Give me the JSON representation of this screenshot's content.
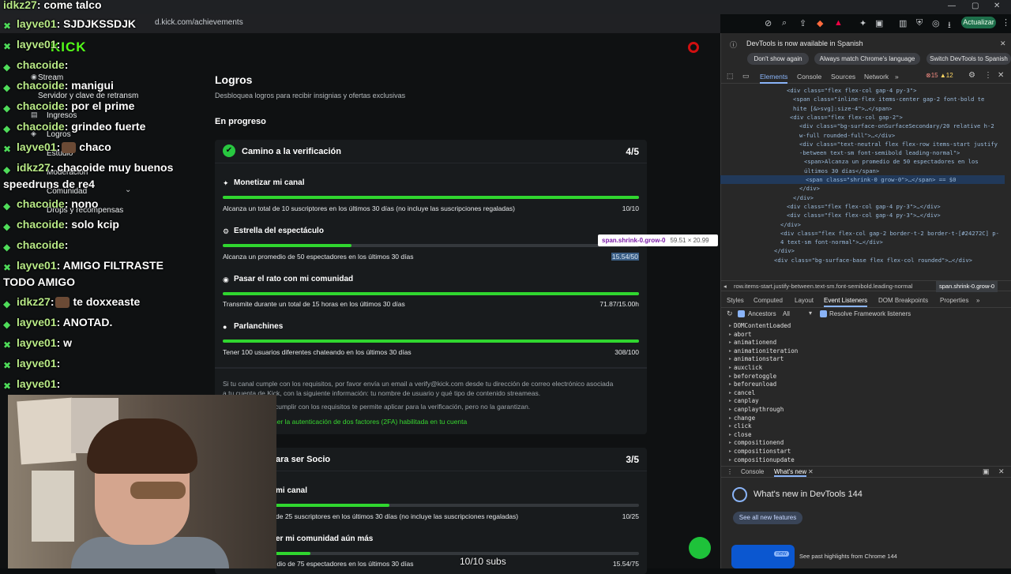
{
  "browser": {
    "url": "d.kick.com/achievements",
    "update_label": "Actualizar"
  },
  "sidebar": {
    "items": [
      {
        "icon": "radio-icon",
        "label": "Stream"
      },
      {
        "icon": "key-icon",
        "label": "Servidor y clave de retransm"
      },
      {
        "icon": "dollar-icon",
        "label": "Ingresos"
      },
      {
        "icon": "medal-icon",
        "label": "Logros"
      },
      {
        "icon": "studio-icon",
        "label": "Estudio"
      },
      {
        "icon": "shield-icon",
        "label": "Moderación"
      },
      {
        "icon": "users-icon",
        "label": "Comunidad"
      },
      {
        "icon": "gift-icon",
        "label": "Drops y recompensas"
      }
    ]
  },
  "page": {
    "title": "Logros",
    "subtitle": "Desbloquea logros para recibir insignias y ofertas exclusivas",
    "section": "En progreso"
  },
  "cards": [
    {
      "title": "Camino a la verificación",
      "count": "4/5",
      "achievements": [
        {
          "icon": "sparkle-icon",
          "title": "Monetizar mi canal",
          "desc": "Alcanza un total de 10 suscriptores en los últimos 30 días (no incluye las suscripciones regaladas)",
          "value": "10/10",
          "progress": 1.0
        },
        {
          "icon": "star-icon",
          "title": "Estrella del espectáculo",
          "desc": "Alcanza un promedio de 50 espectadores en los últimos 30 días",
          "value": "15.54/50",
          "progress": 0.31
        },
        {
          "icon": "broadcast-icon",
          "title": "Pasar el rato con mi comunidad",
          "desc": "Transmite durante un total de 15 horas en los últimos 30 días",
          "value": "71.87/15.00h",
          "progress": 1.0
        },
        {
          "icon": "chat-icon",
          "title": "Parlanchines",
          "desc": "Tener 100 usuarios diferentes chateando en los últimos 30 días",
          "value": "308/100",
          "progress": 1.0
        }
      ],
      "info_line1": "Si tu canal cumple con los requisitos, por favor envía un email a verify@kick.com desde tu dirección de correo electrónico asociada",
      "info_line2": "a tu cuenta de Kick, con la siguiente información: tu nombre de usuario y qué tipo de contenido streameas.",
      "info_line3": "cumplir con los requisitos te permite aplicar para la verificación, pero no la garantizan.",
      "info_link": "ner la autenticación de dos factores (2FA) habilitada en tu cuenta"
    },
    {
      "title": "ara ser Socio",
      "count": "3/5",
      "achievements": [
        {
          "title": "mi canal",
          "desc": "de 25 suscriptores en los últimos 30 días (no incluye las suscripciones regaladas)",
          "value": "10/25",
          "progress": 0.4
        },
        {
          "title": "er mi comunidad aún más",
          "desc": "Alcanza un promedio de 75 espectadores en los últimos 30 días",
          "value": "15.54/75",
          "progress": 0.21
        }
      ]
    }
  ],
  "tooltip": {
    "selector": "span.shrink-0.grow-0",
    "size": "59.51 × 20.99"
  },
  "chat": [
    {
      "user": "idkz27",
      "msg": ": come talco"
    },
    {
      "user": "layve01",
      "msg": ": SJDJKSSDJK"
    },
    {
      "user": "layve01",
      "msg": ":"
    },
    {
      "user": "chacoide",
      "msg": ":"
    },
    {
      "user": "chacoide",
      "msg": ": manigui"
    },
    {
      "user": "chacoide",
      "msg": ": por el prime"
    },
    {
      "user": "chacoide",
      "msg": ": grindeo fuerte"
    },
    {
      "user": "layve01",
      "msg": ":",
      "extra": "chaco"
    },
    {
      "user": "idkz27",
      "msg": ": chacoide muy buenos"
    },
    {
      "user": "",
      "msg": "speedruns de re4"
    },
    {
      "user": "chacoide",
      "msg": ": nono"
    },
    {
      "user": "chacoide",
      "msg": ": solo kcip"
    },
    {
      "user": "chacoide",
      "msg": ":"
    },
    {
      "user": "layve01",
      "msg": ": AMIGO FILTRASTE"
    },
    {
      "user": "",
      "msg": "TODO AMIGO"
    },
    {
      "user": "idkz27",
      "msg": ":",
      "extra": "te doxxeaste"
    },
    {
      "user": "layve01",
      "msg": ": ANOTAD."
    },
    {
      "user": "layve01",
      "msg": ": w"
    },
    {
      "user": "layve01",
      "msg": ":"
    },
    {
      "user": "layve01",
      "msg": ":"
    }
  ],
  "overlay_subs": "10/10 subs",
  "devtools": {
    "info_msg": "DevTools is now available in Spanish",
    "btn_dont_show": "Don't show again",
    "btn_match": "Always match Chrome's language",
    "btn_switch": "Switch DevTools to Spanish",
    "tabs": [
      "Elements",
      "Console",
      "Sources",
      "Network"
    ],
    "errors": "15",
    "warnings": "12",
    "dom_lines": [
      "<div class=\"flex flex-col gap-4 py-3\">",
      "<span class=\"inline-flex items-center gap-2 font-bold te",
      "hite [&>svg]:size-4\">…</span>",
      "<div class=\"flex flex-col gap-2\">",
      "<div class=\"bg-surface-onSurfaceSecondary/20 relative h-2",
      "w-full rounded-full\">…</div>",
      "<div class=\"text-neutral flex flex-row items-start justify",
      "-between text-sm font-semibold leading-normal\">",
      "<span>Alcanza un promedio de 50 espectadores en los",
      "últimos 30 días</span>",
      "<span class=\"shrink-0 grow-0\">…</span> == $0",
      "</div>",
      "</div>",
      "<div class=\"flex flex-col gap-4 py-3\">…</div>",
      "<div class=\"flex flex-col gap-4 py-3\">…</div>",
      "</div>",
      "<div class=\"flex flex-col gap-2 border-t-2 border-t-[#24272C] p-",
      "4 text-sm font-normal\">…</div>",
      "</div>",
      "<div class=\"bg-surface-base flex flex-col rounded\">…</div>"
    ],
    "breadcrumb": "row.items-start.justify-between.text-sm.font-semibold.leading-normal",
    "breadcrumb_last": "span.shrink-0.grow-0",
    "pane_tabs": [
      "Styles",
      "Computed",
      "Layout",
      "Event Listeners",
      "DOM Breakpoints",
      "Properties"
    ],
    "ancestors_label": "Ancestors",
    "all_label": "All",
    "framework_label": "Resolve Framework listeners",
    "events": [
      "DOMContentLoaded",
      "abort",
      "animationend",
      "animationiteration",
      "animationstart",
      "auxclick",
      "beforetoggle",
      "beforeunload",
      "cancel",
      "canplay",
      "canplaythrough",
      "change",
      "click",
      "close",
      "compositionend",
      "compositionstart",
      "compositionupdate"
    ],
    "drawer_tabs": [
      "Console",
      "What's new"
    ],
    "whats_new_title": "What's new in DevTools 144",
    "see_all": "See all new features",
    "new_badge": "new",
    "highlights": "See past highlights from Chrome 144"
  }
}
